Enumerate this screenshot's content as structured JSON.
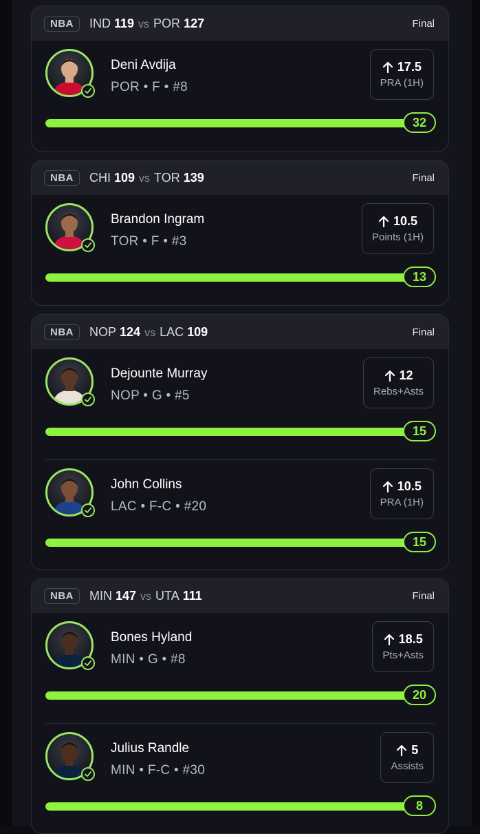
{
  "accent_color": "#8ff23e",
  "cards": [
    {
      "league": "NBA",
      "away_team": "IND",
      "away_score": "119",
      "vs": "vs",
      "home_team": "POR",
      "home_score": "127",
      "status": "Final",
      "players": [
        {
          "name": "Deni Avdija",
          "meta": "POR • F • #8",
          "direction_icon": "arrow-up-icon",
          "line": "17.5",
          "stat": "PRA (1H)",
          "result": "32",
          "progress": 1.0,
          "jersey_color": "#c8102e",
          "skin": "#d8a988"
        }
      ]
    },
    {
      "league": "NBA",
      "away_team": "CHI",
      "away_score": "109",
      "vs": "vs",
      "home_team": "TOR",
      "home_score": "139",
      "status": "Final",
      "players": [
        {
          "name": "Brandon Ingram",
          "meta": "TOR • F • #3",
          "direction_icon": "arrow-up-icon",
          "line": "10.5",
          "stat": "Points (1H)",
          "result": "13",
          "progress": 1.0,
          "jersey_color": "#ce1141",
          "skin": "#9a6a4a"
        }
      ]
    },
    {
      "league": "NBA",
      "away_team": "NOP",
      "away_score": "124",
      "vs": "vs",
      "home_team": "LAC",
      "home_score": "109",
      "status": "Final",
      "players": [
        {
          "name": "Dejounte Murray",
          "meta": "NOP • G • #5",
          "direction_icon": "arrow-up-icon",
          "line": "12",
          "stat": "Rebs+Asts",
          "result": "15",
          "progress": 1.0,
          "jersey_color": "#e8e2d8",
          "skin": "#5a3826"
        },
        {
          "name": "John Collins",
          "meta": "LAC • F-C • #20",
          "direction_icon": "arrow-up-icon",
          "line": "10.5",
          "stat": "PRA (1H)",
          "result": "15",
          "progress": 1.0,
          "jersey_color": "#1d428a",
          "skin": "#7a5038"
        }
      ]
    },
    {
      "league": "NBA",
      "away_team": "MIN",
      "away_score": "147",
      "vs": "vs",
      "home_team": "UTA",
      "home_score": "111",
      "status": "Final",
      "players": [
        {
          "name": "Bones Hyland",
          "meta": "MIN • G • #8",
          "direction_icon": "arrow-up-icon",
          "line": "18.5",
          "stat": "Pts+Asts",
          "result": "20",
          "progress": 1.0,
          "jersey_color": "#0c2340",
          "skin": "#4a2e20"
        },
        {
          "name": "Julius Randle",
          "meta": "MIN • F-C • #30",
          "direction_icon": "arrow-up-icon",
          "line": "5",
          "stat": "Assists",
          "result": "8",
          "progress": 1.0,
          "jersey_color": "#0c2340",
          "skin": "#4e2f1e"
        }
      ]
    }
  ]
}
